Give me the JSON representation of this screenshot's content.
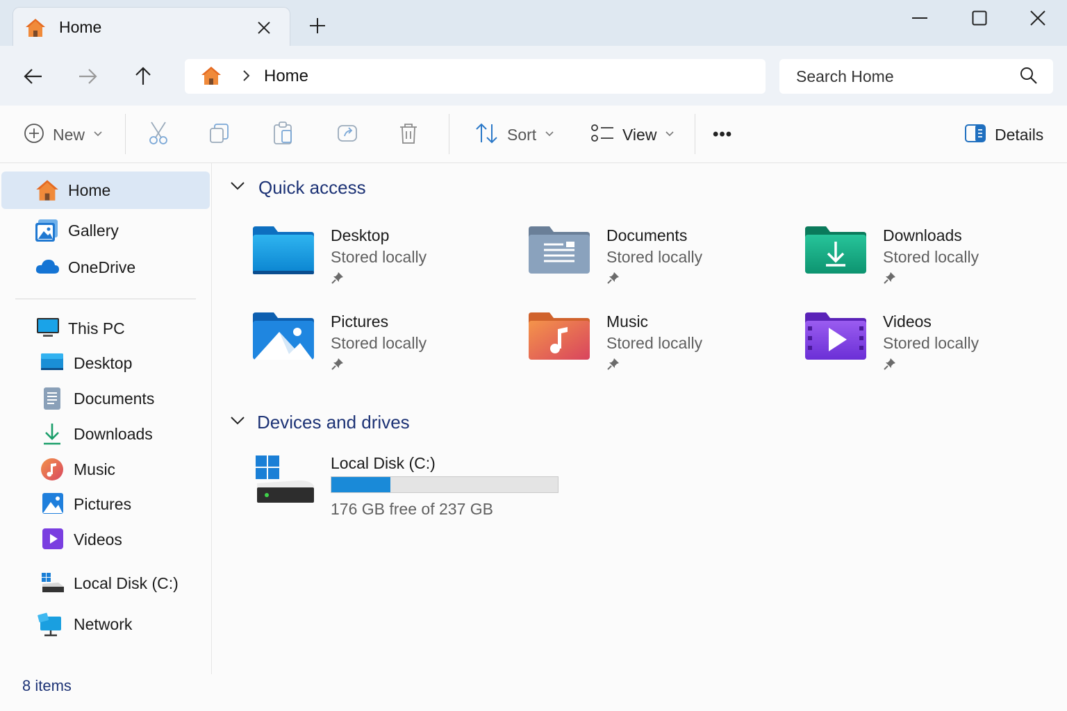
{
  "tab": {
    "title": "Home",
    "close_icon": "close-icon",
    "new_tab_icon": "plus-icon"
  },
  "window_controls": {
    "minimize": "minimize-icon",
    "maximize": "maximize-icon",
    "close": "close-icon"
  },
  "address": {
    "location": "Home",
    "search_placeholder": "Search Home"
  },
  "toolbar": {
    "new_label": "New",
    "sort_label": "Sort",
    "view_label": "View",
    "more_label": "•••",
    "details_label": "Details"
  },
  "sidebar": {
    "items": [
      {
        "label": "Home",
        "active": true
      },
      {
        "label": "Gallery"
      },
      {
        "label": "OneDrive"
      },
      {
        "label": "This PC"
      },
      {
        "label": "Desktop"
      },
      {
        "label": "Documents"
      },
      {
        "label": "Downloads"
      },
      {
        "label": "Music"
      },
      {
        "label": "Pictures"
      },
      {
        "label": "Videos"
      },
      {
        "label": "Local Disk (C:)"
      },
      {
        "label": "Network"
      }
    ]
  },
  "quick_access": {
    "title": "Quick access",
    "items": [
      {
        "name": "Desktop",
        "status": "Stored locally"
      },
      {
        "name": "Documents",
        "status": "Stored locally"
      },
      {
        "name": "Downloads",
        "status": "Stored locally"
      },
      {
        "name": "Pictures",
        "status": "Stored locally"
      },
      {
        "name": "Music",
        "status": "Stored locally"
      },
      {
        "name": "Videos",
        "status": "Stored locally"
      }
    ]
  },
  "devices": {
    "title": "Devices and drives",
    "drives": [
      {
        "name": "Local Disk (C:)",
        "free_text": "176 GB free of 237 GB",
        "used_fraction": 0.26
      }
    ]
  },
  "status": {
    "item_count": "8 items"
  },
  "colors": {
    "accent": "#1a8ad8",
    "section_title": "#1c3275",
    "active_nav": "#dbe7f5"
  }
}
